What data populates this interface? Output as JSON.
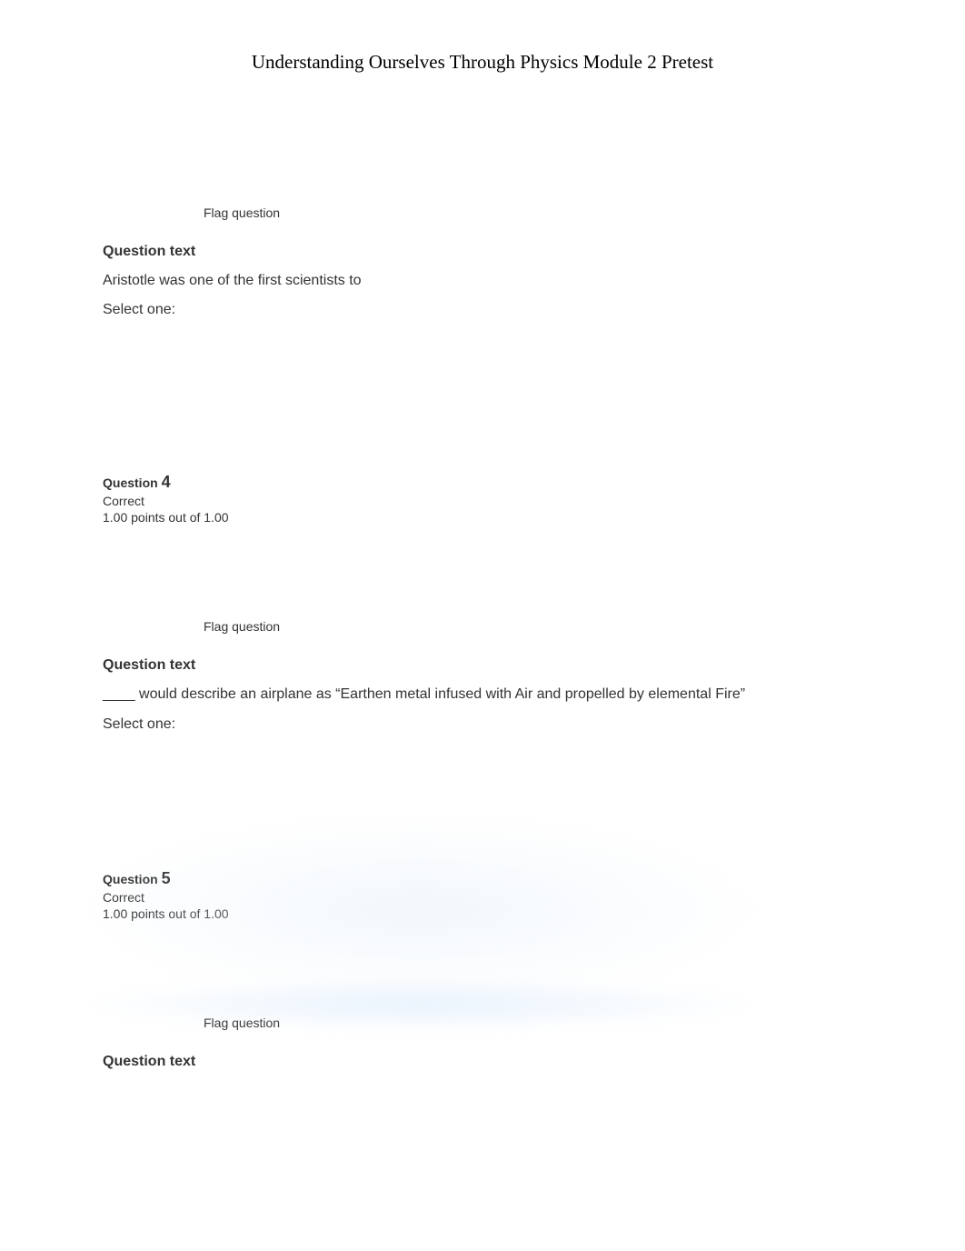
{
  "page_title": "Understanding Ourselves Through Physics Module 2 Pretest",
  "q3": {
    "flag_label": "Flag question",
    "heading": "Question text",
    "prompt": "Aristotle was one of the first scientists to",
    "select_label": "Select one:"
  },
  "q4": {
    "label_prefix": "Question ",
    "number": "4",
    "status": "Correct",
    "points": "1.00 points out of 1.00",
    "flag_label": "Flag question",
    "heading": "Question text",
    "prompt": "____ would describe an airplane as “Earthen metal infused with Air and propelled by elemental Fire”",
    "select_label": "Select one:"
  },
  "q5": {
    "label_prefix": "Question ",
    "number": "5",
    "status": "Correct",
    "points": "1.00 points out of 1.00",
    "flag_label": "Flag question",
    "heading": "Question text"
  }
}
